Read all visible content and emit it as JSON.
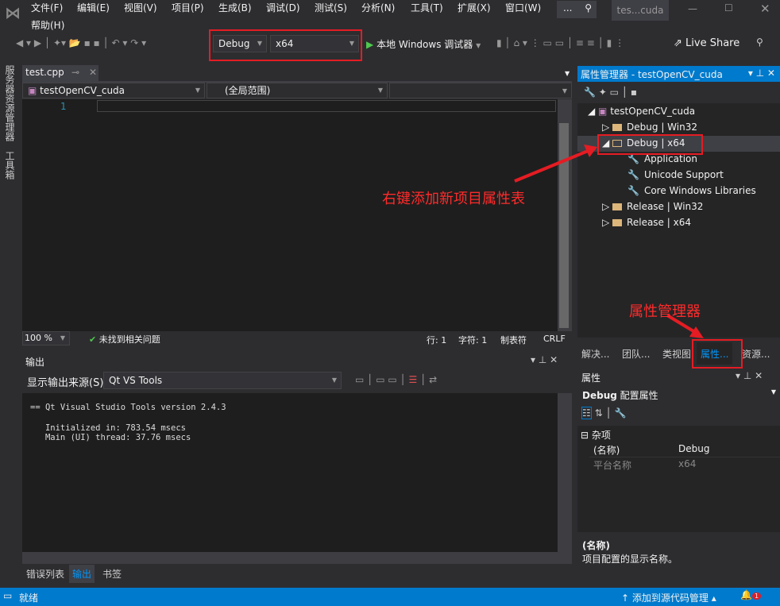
{
  "menu": [
    "文件(F)",
    "编辑(E)",
    "视图(V)",
    "项目(P)",
    "生成(B)",
    "调试(D)",
    "测试(S)",
    "分析(N)",
    "工具(T)",
    "扩展(X)",
    "窗口(W)",
    "帮助(H)"
  ],
  "search_label": "...",
  "window_title": "tes...cuda",
  "toolbar": {
    "config": "Debug",
    "platform": "x64",
    "run": "本地 Windows 调试器",
    "live_share": "Live Share"
  },
  "side_tabs": [
    "服务器资源管理器",
    "工具箱"
  ],
  "editor": {
    "tab": "test.cpp",
    "project_dd": "testOpenCV_cuda",
    "scope_dd": "(全局范围)",
    "line_no": "1",
    "zoom": "100 %",
    "status": "未找到相关问题",
    "row": "行: 1",
    "col": "字符: 1",
    "tabs": "制表符",
    "eol": "CRLF"
  },
  "output": {
    "title": "输出",
    "source_label": "显示输出来源(S):",
    "source": "Qt VS Tools",
    "lines": [
      "== Qt Visual Studio Tools version 2.4.3",
      "",
      "   Initialized in: 783.54 msecs",
      "   Main (UI) thread: 37.76 msecs"
    ]
  },
  "bottom_tabs": [
    "错误列表",
    "输出",
    "书签"
  ],
  "prop_manager": {
    "title": "属性管理器 - testOpenCV_cuda",
    "root": "testOpenCV_cuda",
    "items": [
      "Debug | Win32",
      "Debug | x64",
      "Application",
      "Unicode Support",
      "Core Windows Libraries",
      "Release | Win32",
      "Release | x64"
    ]
  },
  "annotations": {
    "right_click": "右键添加新项目属性表",
    "prop_mgr": "属性管理器"
  },
  "right_tabs": [
    "解决...",
    "团队...",
    "类视图",
    "属性...",
    "资源..."
  ],
  "properties": {
    "title": "属性",
    "object": "Debug",
    "object_type": "配置属性",
    "category": "杂项",
    "rows": [
      {
        "name": "(名称)",
        "value": "Debug"
      },
      {
        "name": "平台名称",
        "value": "x64"
      }
    ],
    "desc_title": "(名称)",
    "desc": "项目配置的显示名称。"
  },
  "statusbar": {
    "ready": "就绪",
    "source_control": "添加到源代码管理",
    "notif": "1"
  },
  "colors": {
    "accent": "#007acc",
    "annotation": "#e51c23"
  }
}
